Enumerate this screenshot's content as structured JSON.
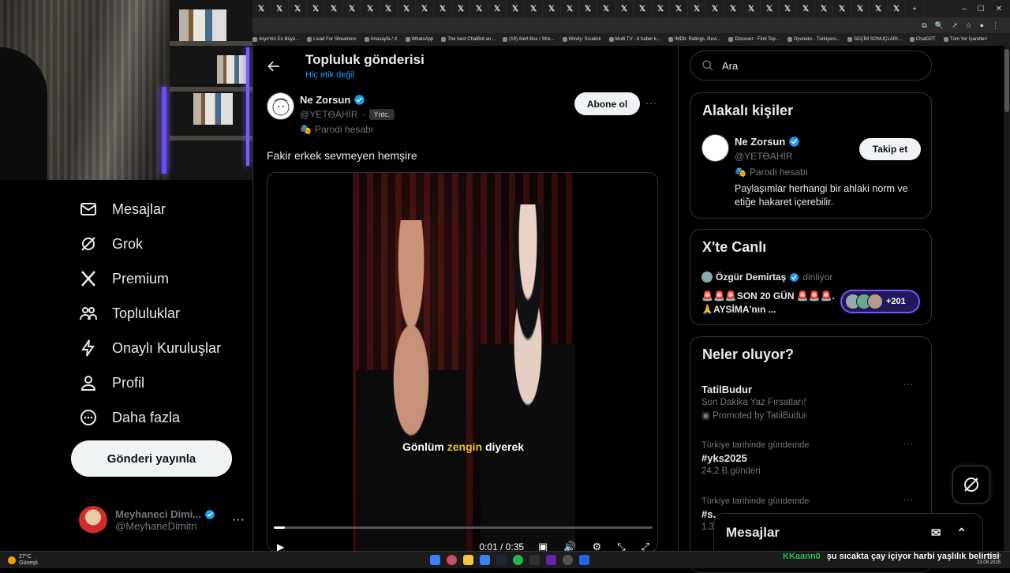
{
  "browser": {
    "tab_favicons": [
      "𝕏",
      "𝕏",
      "𝕏",
      "𝕏",
      "𝕏",
      "𝕏",
      "𝕏",
      "𝕏",
      "𝕏",
      "𝕏",
      "𝕏",
      "𝕏",
      "𝕏",
      "𝕏",
      "𝕏",
      "𝕏",
      "𝕏",
      "𝕏",
      "𝕏",
      "𝕏",
      "𝕏",
      "𝕏",
      "𝕏",
      "𝕏",
      "𝕏",
      "𝕏",
      "𝕏",
      "𝕏",
      "𝕏",
      "𝕏",
      "𝕏",
      "𝕏",
      "𝕏",
      "𝕏",
      "𝕏",
      "𝕏"
    ],
    "new_tab_label": "+",
    "bookmarks": [
      "rkiye'nin En Büyü...",
      "Livad For Streamers",
      "Anasayfa / X",
      "WhatsApp",
      "The best ChatBot an...",
      "(19) Alert Box / Stre...",
      "Windy: Sıcaklık",
      "Multi TV - 6 haber k...",
      "IMDb: Ratings, Revi...",
      "Discover - Find Top...",
      "Oyuneks - Türkiyeni...",
      "SEÇİM SONUÇLARI...",
      "ChatGPT",
      "Tüm Yer İşaretleri"
    ]
  },
  "nav": {
    "items": [
      {
        "label": "Mesajlar",
        "icon": "mail-icon"
      },
      {
        "label": "Grok",
        "icon": "grok-icon"
      },
      {
        "label": "Premium",
        "icon": "x-logo-icon"
      },
      {
        "label": "Topluluklar",
        "icon": "communities-icon"
      },
      {
        "label": "Onaylı Kuruluşlar",
        "icon": "lightning-icon"
      },
      {
        "label": "Profil",
        "icon": "profile-icon"
      },
      {
        "label": "Daha fazla",
        "icon": "more-circle-icon"
      }
    ],
    "post_button": "Gönderi yayınla",
    "account": {
      "name": "Meyhaneci Dimi...",
      "handle": "@MeyhaneDimitri",
      "more": "···"
    }
  },
  "main": {
    "title": "Topluluk gönderisi",
    "subtitle": "Hiç etik değil",
    "author": {
      "name": "Ne Zorsun",
      "handle": "@YETƟAHİR",
      "dot": "·",
      "badge": "Yntc.",
      "parody": "Parodi hesabı"
    },
    "subscribe_button": "Abone ol",
    "more": "···",
    "post_text": "Fakir erkek sevmeyen hemşire",
    "video": {
      "caption_before": "Gönlüm ",
      "caption_highlight": "zengin",
      "caption_after": " diyerek",
      "time": "0:01 / 0:35",
      "progress": 0.03
    }
  },
  "right": {
    "search_placeholder": "Ara",
    "related_people": {
      "title": "Alakalı kişiler",
      "name": "Ne Zorsun",
      "handle": "@YETƟAHİR",
      "parody": "Parodi hesabı",
      "bio": "Paylaşımlar herhangi bir ahlaki norm ve etiğe hakaret içerebilir.",
      "follow_button": "Takip et"
    },
    "live": {
      "title": "X'te Canlı",
      "host": "Özgür Demirtaş",
      "status": "dinliyor",
      "space_title": "🚨🚨🚨SON 20 GÜN 🚨🚨🚨.  🙏AYSİMA'nın ...",
      "listener_count": "+201"
    },
    "trends": {
      "title": "Neler oluyor?",
      "items": [
        {
          "context": "",
          "name": "TatilBudur",
          "sub": "Son Dakika Yaz Fırsatları!",
          "meta": "Promoted by TatilBudur"
        },
        {
          "context": "Türkiye tarihinde gündemde",
          "name": "#yks2025",
          "sub": "24,2 B gönderi",
          "meta": ""
        },
        {
          "context": "Türkiye tarihinde gündemde",
          "name": "#s...",
          "sub": "1.3...",
          "meta": ""
        }
      ]
    },
    "messages_drawer": "Mesajlar"
  },
  "overlay_chat": {
    "user": "KKaann0",
    "text": "şu sıcakta çay içiyor harbi yaşlılık belirtisi"
  },
  "taskbar": {
    "weather_temp": "27°C",
    "weather_desc": "Güneşli",
    "time": "12:00",
    "date": "23.08.2025"
  }
}
